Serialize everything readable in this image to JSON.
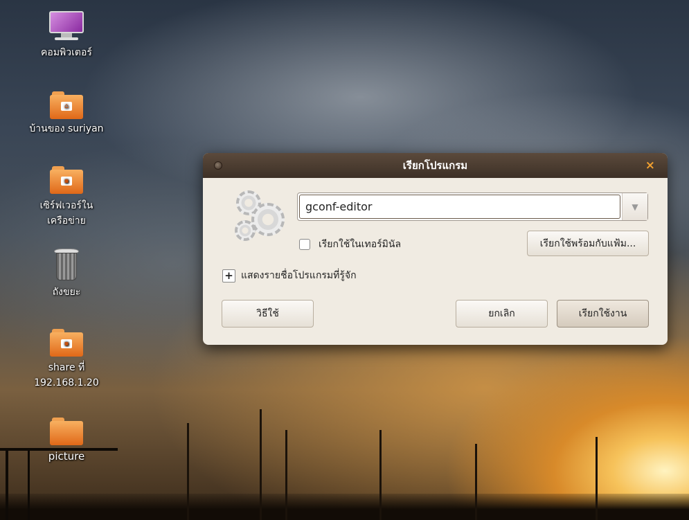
{
  "desktop": {
    "icons": [
      {
        "label": "คอมพิวเตอร์",
        "icon": "computer-icon"
      },
      {
        "label": "บ้านของ suriyan",
        "icon": "home-folder-icon"
      },
      {
        "label": "เซิร์ฟเวอร์ในเครือข่าย",
        "icon": "network-folder-icon"
      },
      {
        "label": "ถังขยะ",
        "icon": "trash-icon"
      },
      {
        "label": "share ที่ 192.168.1.20",
        "icon": "network-share-icon"
      },
      {
        "label": "picture",
        "icon": "folder-icon"
      }
    ]
  },
  "dialog": {
    "title": "เรียกโปรแกรม",
    "close_glyph": "×",
    "command_value": "gconf-editor",
    "dropdown_glyph": "▼",
    "run_in_terminal_label": "เรียกใช้ในเทอร์มินัล",
    "run_with_file_label": "เรียกใช้พร้อมกับแฟ้ม...",
    "expander_glyph": "+",
    "show_known_apps_label": "แสดงรายชื่อโปรแกรมที่รู้จัก",
    "help_label": "วิธีใช้",
    "cancel_label": "ยกเลิก",
    "run_label": "เรียกใช้งาน",
    "accent_color": "#f0a030",
    "titlebar_color": "#4a3b30"
  }
}
